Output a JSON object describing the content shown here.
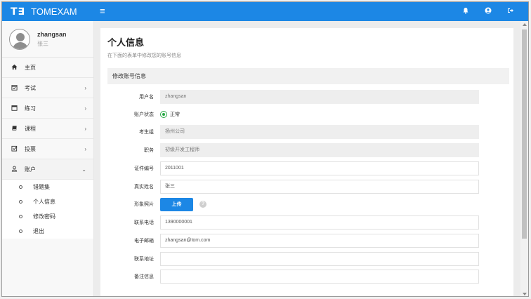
{
  "brand": {
    "logo": "T∃",
    "name": "TOMEXAM"
  },
  "topbar": {
    "menu_icon": "≡",
    "bell_icon": "bell-icon",
    "user_icon": "user-circle-icon",
    "logout_icon": "logout-icon"
  },
  "user": {
    "name": "zhangsan",
    "real_name": "张三"
  },
  "nav": {
    "home": "主页",
    "exam": "考试",
    "practice": "练习",
    "course": "课程",
    "vote": "投票",
    "account": "账户"
  },
  "subnav": [
    "错题集",
    "个人信息",
    "修改密码",
    "退出"
  ],
  "page": {
    "title": "个人信息",
    "subtitle": "在下面的表单中修改您的账号信息",
    "section": "修改账号信息"
  },
  "form": {
    "username_label": "用户名",
    "username": "zhangsan",
    "status_label": "账户状态",
    "status": "正常",
    "group_label": "考生组",
    "group": "扬州公司",
    "position_label": "职务",
    "position": "初级开发工程师",
    "cert_label": "证件编号",
    "cert": "2011001",
    "realname_label": "真实姓名",
    "realname": "张三",
    "photo_label": "形象照片",
    "upload": "上传",
    "help": "?",
    "phone_label": "联系电话",
    "phone": "1390000001",
    "email_label": "电子邮箱",
    "email": "zhangsan@tom.com",
    "address_label": "联系地址",
    "address": "",
    "remark_label": "备注信息",
    "remark": ""
  },
  "colors": {
    "primary": "#1c87e5",
    "status_green": "#27a844"
  }
}
